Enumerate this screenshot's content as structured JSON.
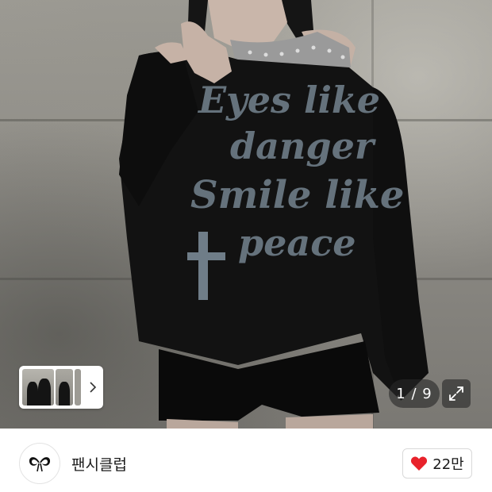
{
  "gallery": {
    "counter_text": "1 / 9",
    "expand_icon": "expand-icon",
    "thumbnail_next_icon": "chevron-right-icon",
    "shirt_print": {
      "line1": "Eyes like",
      "line2": "danger",
      "line3": "Smile like",
      "line4": "peace"
    }
  },
  "store": {
    "name": "팬시클럽",
    "logo_icon": "fancy-club-logo",
    "like_icon": "heart-icon",
    "like_count": "22만",
    "like_color": "#e8222b"
  }
}
